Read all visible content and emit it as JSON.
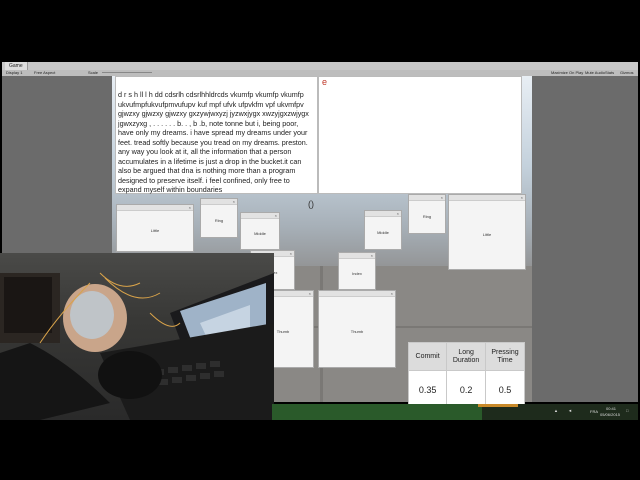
{
  "editor": {
    "tab_label": "Game",
    "display_label": "Display 1",
    "aspect_label": "Free Aspect",
    "scale_label": "Scale",
    "toolbar_right": [
      "Maximize On Play",
      "Mute Audio",
      "Stats",
      "Gizmos"
    ]
  },
  "text_panel": {
    "content": "d r s h ll l h dd cdsrlh cdsrlhhldrcds vkumfp  vkumfp vkumfp ukvufmpfukvufpmvufupv kuf mpf ufvk ufpvkfm vpf ukvmfpv gjwzxy  gjwzxy  gjwzxy gxzywjwxyzj jyzwxjygx xwzyjgxzwjygx jgwxzyxg  , .  .  .  .  .  .  b.  .  , b .b, note tonne but i, being poor, have only my dreams. i have spread my dreams under your feet. tread softly because you tread on my dreams. preston. any way you look at it, all the information that a person accumulates in a lifetime is just a drop in the bucket.it can also be argued that dna is nothing more than a program designed to preserve itself. i feel confined, only free to expand myself within boundaries"
  },
  "right_panel": {
    "letter": "e"
  },
  "paren_text": "()",
  "finger_windows": [
    {
      "label": "Little"
    },
    {
      "label": "Ring"
    },
    {
      "label": "Middle"
    },
    {
      "label": "Index"
    },
    {
      "label": "Thumb"
    },
    {
      "label": "Middle"
    },
    {
      "label": "Ring"
    },
    {
      "label": "Little"
    },
    {
      "label": "Index"
    },
    {
      "label": "Thumb"
    }
  ],
  "params_table": {
    "headers": [
      "Commit",
      "Long Duration",
      "Pressing Time"
    ],
    "values": [
      "0.35",
      "0.2",
      "0.5"
    ]
  },
  "taskbar": {
    "lang": "FRA",
    "time": "00:41",
    "date": "05/06/2015"
  },
  "colors": {
    "accent_letter": "#c0392b",
    "taskbar": "#1e2b1c"
  }
}
